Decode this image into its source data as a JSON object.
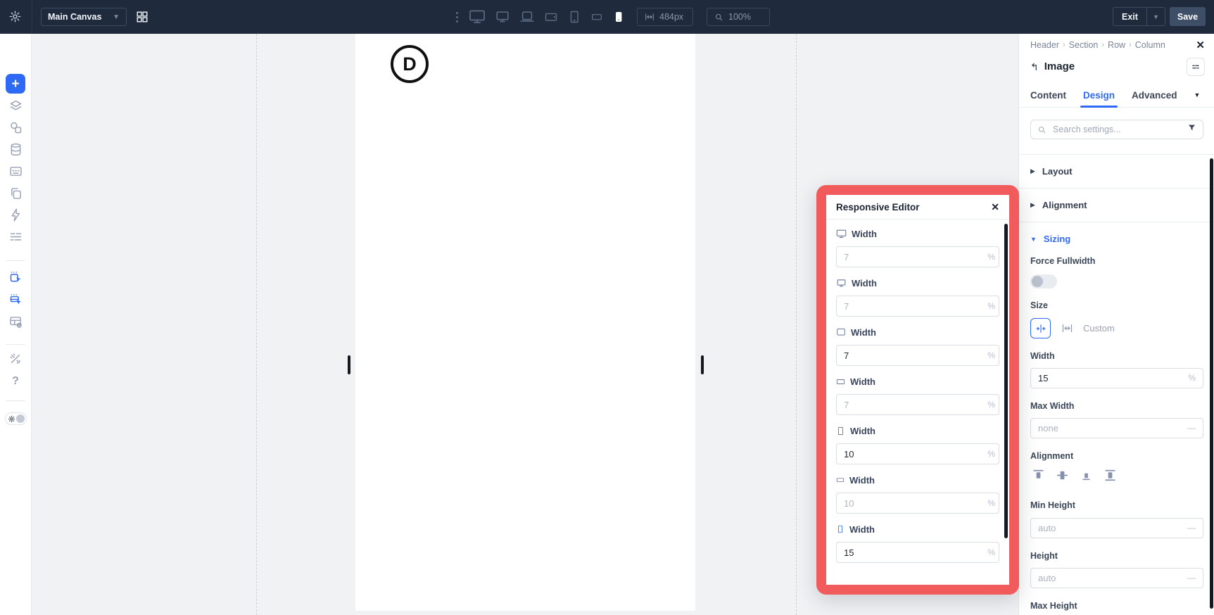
{
  "toolbar": {
    "canvas_selector": "Main Canvas",
    "width_value": "484px",
    "zoom_value": "100%",
    "exit_label": "Exit",
    "save_label": "Save",
    "device_icons": [
      "desktop-extra-large",
      "desktop",
      "laptop",
      "tablet-landscape",
      "tablet",
      "phone-landscape",
      "phone"
    ],
    "active_device": "phone"
  },
  "canvas": {
    "logo_letter": "D"
  },
  "modal": {
    "title": "Responsive Editor",
    "fields": [
      {
        "device": "desktop-extra-large",
        "label": "Width",
        "value": "7",
        "unit": "%",
        "inherited": true
      },
      {
        "device": "desktop",
        "label": "Width",
        "value": "7",
        "unit": "%",
        "inherited": true
      },
      {
        "device": "laptop",
        "label": "Width",
        "value": "7",
        "unit": "%",
        "inherited": false
      },
      {
        "device": "tablet-landscape",
        "label": "Width",
        "value": "7",
        "unit": "%",
        "inherited": true
      },
      {
        "device": "tablet",
        "label": "Width",
        "value": "10",
        "unit": "%",
        "inherited": false
      },
      {
        "device": "phone-landscape",
        "label": "Width",
        "value": "10",
        "unit": "%",
        "inherited": true
      },
      {
        "device": "phone",
        "label": "Width",
        "value": "15",
        "unit": "%",
        "inherited": false
      }
    ]
  },
  "panel": {
    "breadcrumb": [
      "Header",
      "Section",
      "Row",
      "Column"
    ],
    "module_title": "Image",
    "tabs": [
      "Content",
      "Design",
      "Advanced"
    ],
    "active_tab": "Design",
    "search_placeholder": "Search settings...",
    "sections": [
      {
        "label": "Layout",
        "expanded": false
      },
      {
        "label": "Alignment",
        "expanded": false
      },
      {
        "label": "Sizing",
        "expanded": true
      }
    ],
    "sizing": {
      "force_fullwidth_label": "Force Fullwidth",
      "force_fullwidth_on": false,
      "size_label": "Size",
      "size_custom_label": "Custom",
      "width_label": "Width",
      "width_value": "15",
      "width_unit": "%",
      "max_width_label": "Max Width",
      "max_width_placeholder": "none",
      "max_width_unit": "—",
      "alignment_label": "Alignment",
      "min_height_label": "Min Height",
      "min_height_placeholder": "auto",
      "min_height_unit": "—",
      "height_label": "Height",
      "height_placeholder": "auto",
      "height_unit": "—",
      "max_height_label": "Max Height"
    }
  },
  "colors": {
    "accent": "#2e6af4",
    "highlight": "#f15b5b",
    "toolbar_bg": "#1f2b3d"
  }
}
